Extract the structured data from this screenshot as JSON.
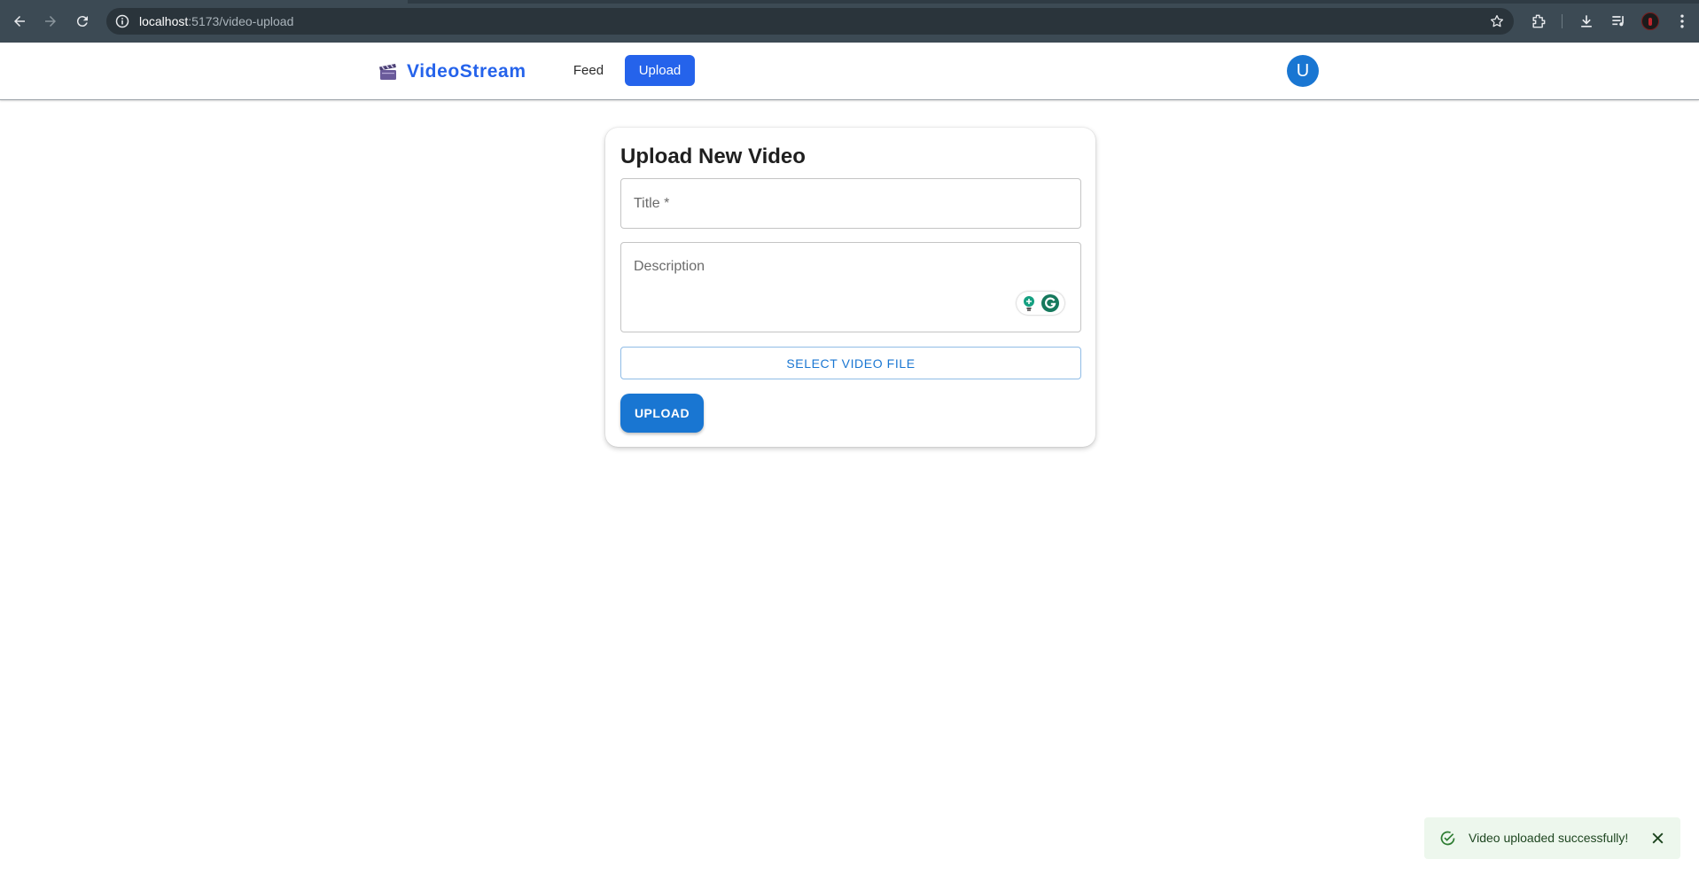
{
  "browser": {
    "url_host": "localhost",
    "url_path": ":5173/video-upload",
    "icons": [
      "back-icon",
      "forward-icon",
      "reload-icon",
      "site-info-icon",
      "bookmark-star-icon",
      "extensions-icon",
      "downloads-icon",
      "media-control-icon",
      "profile-icon",
      "menu-icon"
    ]
  },
  "header": {
    "brand_icon": "clapper-board-icon",
    "brand_name": "VideoStream",
    "nav": {
      "feed_label": "Feed",
      "upload_label": "Upload"
    },
    "avatar_letter": "U"
  },
  "form": {
    "heading": "Upload New Video",
    "title_placeholder": "Title *",
    "title_value": "",
    "description_placeholder": "Description",
    "description_value": "",
    "select_file_label": "SELECT VIDEO FILE",
    "submit_label": "UPLOAD"
  },
  "snackbar": {
    "message": "Video uploaded successfully!",
    "severity": "success"
  },
  "colors": {
    "brand_blue": "#2563eb",
    "primary": "#1976d2",
    "success_bg": "#edf7ed",
    "success_icon": "#2e7d32",
    "chrome_bg": "#3c4a54"
  }
}
